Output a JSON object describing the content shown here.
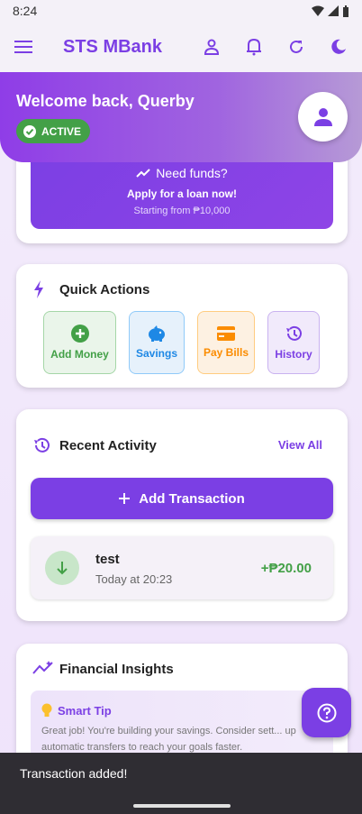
{
  "status_bar": {
    "time": "8:24"
  },
  "app_bar": {
    "title": "STS MBank"
  },
  "welcome": {
    "greeting": "Welcome back, Querby",
    "status": "ACTIVE"
  },
  "loan": {
    "heading": "Need funds?",
    "cta": "Apply for a loan now!",
    "note": "Starting from ₱10,000"
  },
  "quick_actions": {
    "title": "Quick Actions",
    "items": [
      {
        "label": "Add Money",
        "color": "#43a047",
        "bg": "#eaf5ea",
        "border": "#a5d6a7"
      },
      {
        "label": "Savings",
        "color": "#1e88e5",
        "bg": "#e6f1fb",
        "border": "#90caf9"
      },
      {
        "label": "Pay Bills",
        "color": "#fb8c00",
        "bg": "#fdf1e2",
        "border": "#ffcc80"
      },
      {
        "label": "History",
        "color": "#7b3fe4",
        "bg": "#f1eafb",
        "border": "#c9b2f0"
      }
    ]
  },
  "recent_activity": {
    "title": "Recent Activity",
    "view_all": "View All",
    "add_button": "Add Transaction",
    "transactions": [
      {
        "title": "test",
        "time": "Today at 20:23",
        "amount": "+₱20.00"
      }
    ]
  },
  "insights": {
    "title": "Financial Insights",
    "tip_title": "Smart Tip",
    "tip_text": "Great job! You're building your savings. Consider sett... up automatic transfers to reach your goals faster."
  },
  "snackbar": {
    "message": "Transaction added!"
  },
  "colors": {
    "accent": "#7b3fe4",
    "success": "#43a047"
  }
}
